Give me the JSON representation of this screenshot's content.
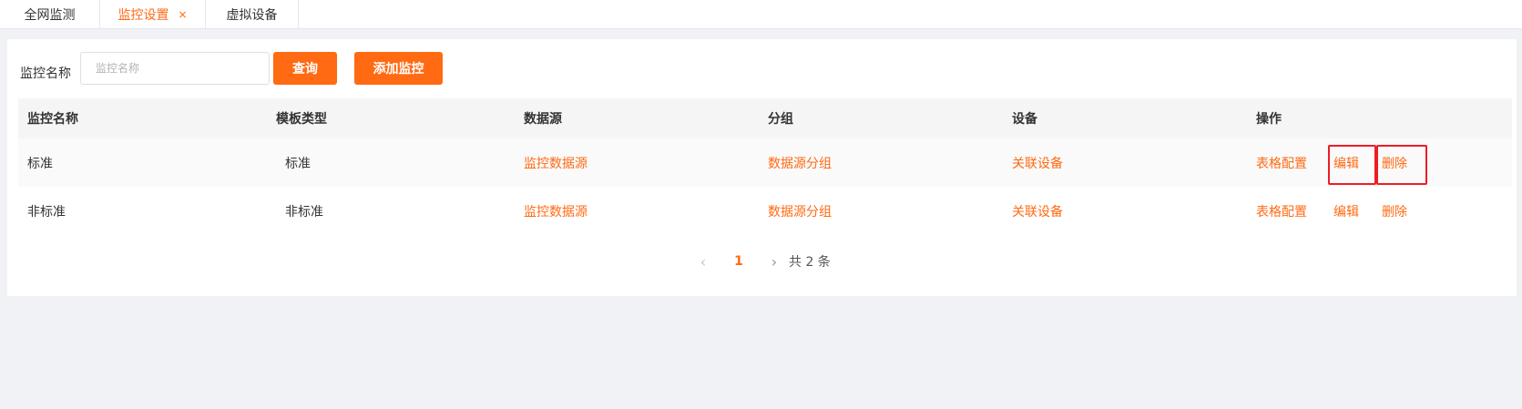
{
  "tabs": [
    {
      "label": "全网监测"
    },
    {
      "label": "监控设置",
      "close": "×"
    },
    {
      "label": "虚拟设备"
    }
  ],
  "filter": {
    "label": "监控名称",
    "placeholder": "监控名称",
    "value": "",
    "query_label": "查询",
    "add_label": "添加监控"
  },
  "table": {
    "headers": [
      "监控名称",
      "模板类型",
      "数据源",
      "分组",
      "设备",
      "操作"
    ],
    "rows": [
      {
        "name": "标准",
        "template": "标准",
        "datasource": "监控数据源",
        "group": "数据源分组",
        "device": "关联设备",
        "ops": [
          "表格配置",
          "编辑",
          "删除"
        ]
      },
      {
        "name": "非标准",
        "template": "非标准",
        "datasource": "监控数据源",
        "group": "数据源分组",
        "device": "关联设备",
        "ops": [
          "表格配置",
          "编辑",
          "删除"
        ]
      }
    ]
  },
  "pagination": {
    "prev_icon": "‹",
    "current_page": "1",
    "next_icon": "›",
    "total_text": "共 2 条"
  },
  "colors": {
    "accent": "#ff6a13",
    "highlight_border": "#ee1c25",
    "page_background": "#f0f2f5"
  }
}
